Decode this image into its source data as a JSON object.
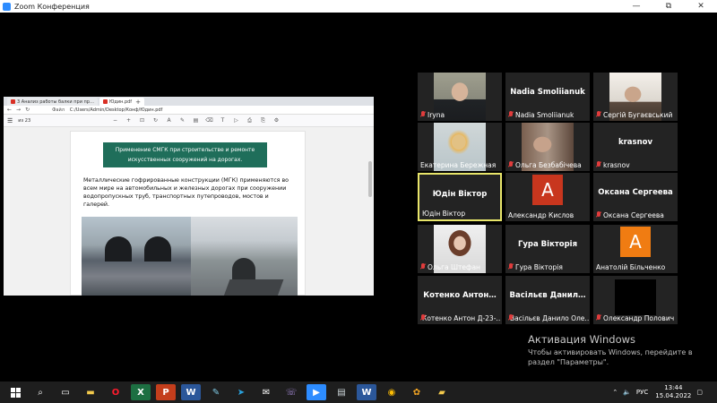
{
  "window": {
    "title": "Zoom Конференция",
    "minimize_glyph": "—",
    "maximize_glyph": "⧉",
    "close_glyph": "✕"
  },
  "shared_screen": {
    "tabs": [
      {
        "label": "3 Анализ работы балки при пр…",
        "active": false
      },
      {
        "label": "Юдин.pdf",
        "active": true
      }
    ],
    "new_tab_glyph": "+",
    "address": {
      "file_label": "Файл",
      "url": "C:/Users/Admin/Desktop/Конф/Юдин.pdf"
    },
    "pdf_toolbar": {
      "page_indicator": "из 23"
    },
    "pdf": {
      "heading_line1": "Применение СМГК при строительстве и ремонте",
      "heading_line2": "искусственных сооружений на дорогах.",
      "body": "Металлические гофрированные конструкции (МГК) применяются во всем мире на автомобильных и железных дорогах при сооружении водопропускных труб, транспортных путепроводов, мостов и галерей."
    }
  },
  "participants": [
    {
      "name": "Iryna",
      "type": "video",
      "muted": true
    },
    {
      "name": "Nadia Smoliianuk",
      "type": "name",
      "center": "Nadia Smoliianuk",
      "muted": true
    },
    {
      "name": "Сергій Бугаєвський",
      "type": "video",
      "muted": true
    },
    {
      "name": "Екатерина Бережная",
      "type": "video",
      "muted": false
    },
    {
      "name": "Ольга Безбабічева",
      "type": "video",
      "muted": true
    },
    {
      "name": "krasnov",
      "type": "name",
      "center": "krasnov",
      "muted": true
    },
    {
      "name": "Юдін Віктор",
      "type": "name",
      "center": "Юдін Віктор",
      "muted": false,
      "active_speaker": true
    },
    {
      "name": "Александр Кислов",
      "type": "avatar",
      "letter": "A",
      "avatar_color": "#c8361e",
      "muted": false
    },
    {
      "name": "Оксана Сергеева",
      "type": "name",
      "center": "Оксана Сергеева",
      "muted": true
    },
    {
      "name": "Ольга Штефан",
      "type": "video",
      "muted": true
    },
    {
      "name": "Гура Вікторія",
      "type": "name",
      "center": "Гура Вікторія",
      "muted": true
    },
    {
      "name": "Анатолій Більченко",
      "type": "avatar",
      "letter": "A",
      "avatar_color": "#f07c12",
      "muted": false
    },
    {
      "name": "Котенко Антон Д-23-…",
      "type": "name",
      "center": "Котенко Антон…",
      "muted": true
    },
    {
      "name": "Васільєв Данило Олександрович",
      "type": "name",
      "center": "Васільєв Данил…",
      "muted": true,
      "label": "Васільєв Данило Оле…"
    },
    {
      "name": "Олександр Полович",
      "type": "black",
      "muted": true
    }
  ],
  "watermark": {
    "title": "Активация Windows",
    "text": "Чтобы активировать Windows, перейдите в раздел \"Параметры\"."
  },
  "taskbar": {
    "language": "РУС",
    "time": "13:44",
    "date": "15.04.2022"
  }
}
